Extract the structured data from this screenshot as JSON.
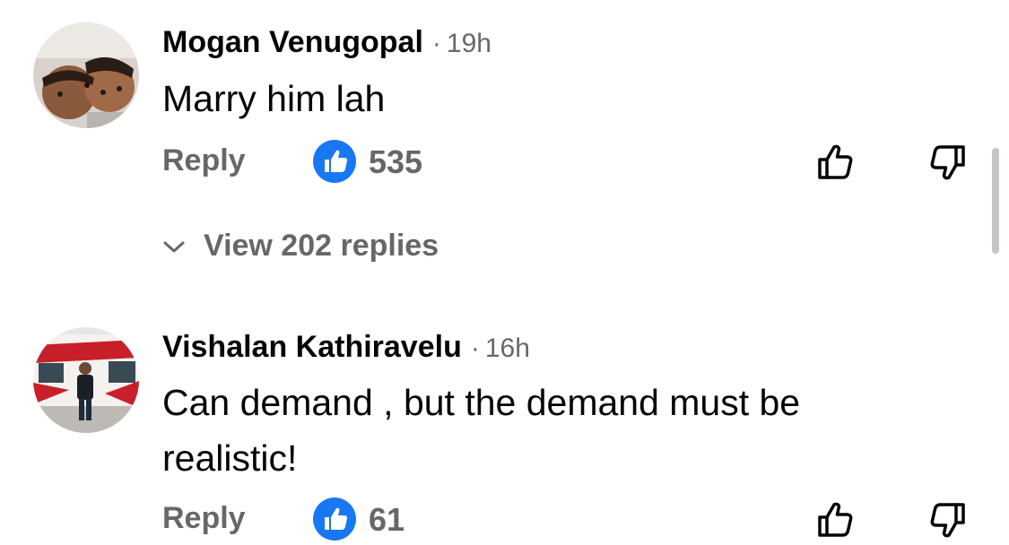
{
  "comments": [
    {
      "author": "Mogan Venugopal",
      "separator": "·",
      "time": "19h",
      "text": "Marry him lah",
      "reply_label": "Reply",
      "like_count": "535",
      "view_replies": "View 202 replies"
    },
    {
      "author": "Vishalan Kathiravelu",
      "separator": "·",
      "time": "16h",
      "text": "Can demand , but the demand must be realistic!",
      "reply_label": "Reply",
      "like_count": "61"
    }
  ],
  "colors": {
    "like_blue": "#1877f2",
    "secondary_text": "#65676b",
    "primary_text": "#050505"
  },
  "icons": [
    "like-reaction-icon",
    "thumbs-up-icon",
    "thumbs-down-icon",
    "chevron-down-icon"
  ]
}
